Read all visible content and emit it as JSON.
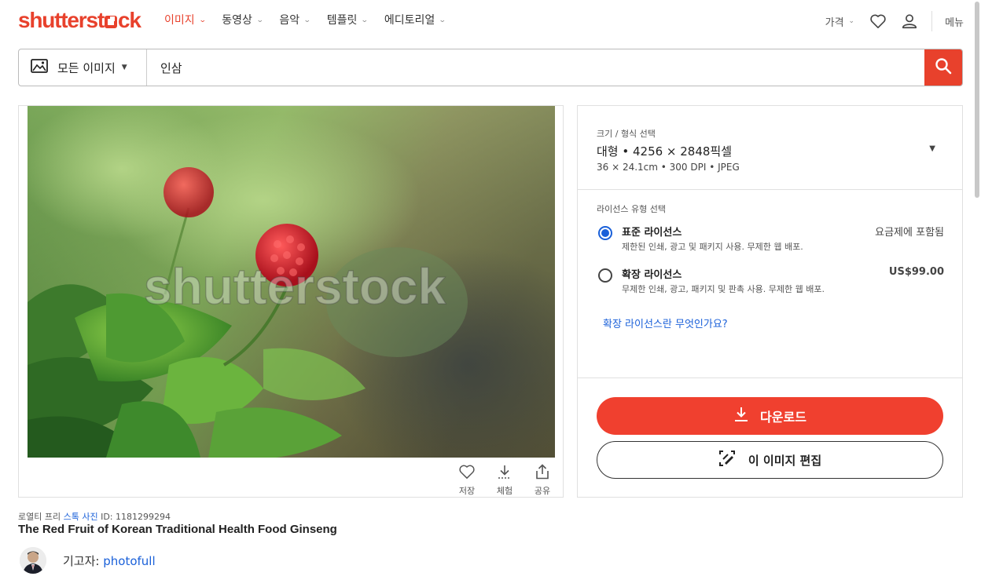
{
  "header": {
    "logo": "shutterstock",
    "nav": [
      {
        "label": "이미지",
        "active": true
      },
      {
        "label": "동영상",
        "active": false
      },
      {
        "label": "음악",
        "active": false
      },
      {
        "label": "템플릿",
        "active": false
      },
      {
        "label": "에디토리얼",
        "active": false
      }
    ],
    "price_label": "가격",
    "menu_label": "메뉴",
    "icons": [
      "heart-icon",
      "user-icon"
    ],
    "accent_color": "#e8412c"
  },
  "search": {
    "type_label": "모든 이미지",
    "query": "인삼",
    "icons": [
      "image-icon",
      "search-icon"
    ]
  },
  "image": {
    "watermark": "shutterstock",
    "actions": [
      {
        "icon": "heart-icon",
        "label": "저장"
      },
      {
        "icon": "download-icon",
        "label": "체험"
      },
      {
        "icon": "share-icon",
        "label": "공유"
      }
    ]
  },
  "license_panel": {
    "size_label": "크기 / 형식 선택",
    "size_main": "대형 • 4256 × 2848픽셀",
    "size_sub": "36 × 24.1cm • 300 DPI • JPEG",
    "license_label": "라이선스 유형 선택",
    "options": [
      {
        "title": "표준 라이선스",
        "desc": "제한된 인쇄, 광고 및 패키지 사용. 무제한 웹 배포.",
        "price": "요금제에 포함됨",
        "selected": true
      },
      {
        "title": "확장 라이선스",
        "desc": "무제한 인쇄, 광고, 패키지 및 판촉 사용. 무제한 웹 배포.",
        "price": "US$99.00",
        "selected": false
      }
    ],
    "extended_link": "확장 라이선스란 무엇인가요?",
    "download_label": "다운로드",
    "edit_label": "이 이미지 편집",
    "button_color": "#f0402f",
    "link_color": "#1a60d9"
  },
  "meta": {
    "royalty_free": "로열티 프리",
    "stock_photo": "스톡 사진",
    "id_text": "ID: 1181299294",
    "title": "The Red Fruit of Korean Traditional Health Food Ginseng",
    "contributor_label": "기고자:",
    "contributor": "photofull"
  }
}
